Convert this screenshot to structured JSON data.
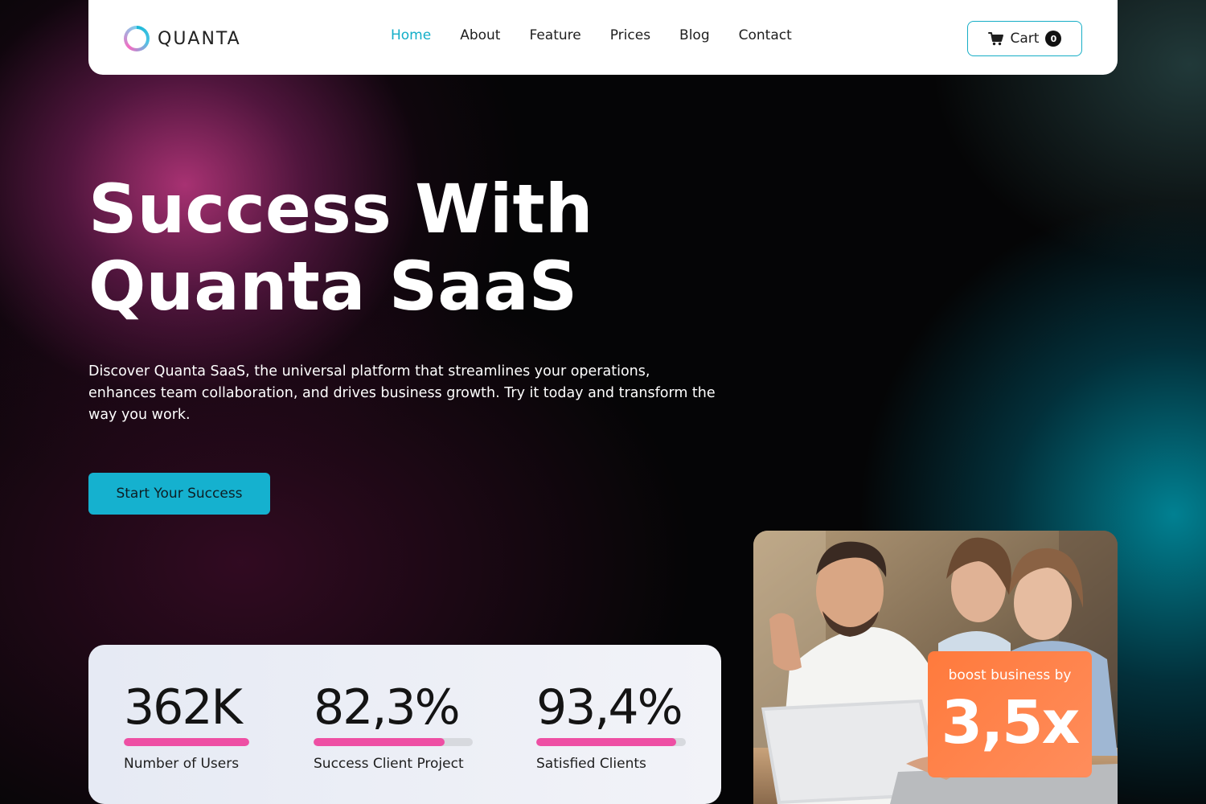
{
  "brand": {
    "name": "QUANTA",
    "icon": "ring-logo-icon"
  },
  "nav": {
    "items": [
      {
        "label": "Home",
        "active": true
      },
      {
        "label": "About",
        "active": false
      },
      {
        "label": "Feature",
        "active": false
      },
      {
        "label": "Prices",
        "active": false
      },
      {
        "label": "Blog",
        "active": false
      },
      {
        "label": "Contact",
        "active": false
      }
    ],
    "cart": {
      "label": "Cart",
      "count": "0",
      "icon": "cart-icon"
    }
  },
  "hero": {
    "title_line1": "Success With",
    "title_line2": "Quanta SaaS",
    "description": "Discover Quanta SaaS, the universal platform that streamlines your operations, enhances team collaboration, and drives business growth. Try it today and transform the way you work.",
    "cta_label": "Start Your Success"
  },
  "stats": [
    {
      "value": "362K",
      "label": "Number of Users",
      "progress": 1.0
    },
    {
      "value": "82,3%",
      "label": "Success Client Project",
      "progress": 0.823
    },
    {
      "value": "93,4%",
      "label": "Satisfied Clients",
      "progress": 0.934
    }
  ],
  "boost": {
    "label": "boost business by",
    "value": "3,5x"
  },
  "colors": {
    "accent": "#15b1cf",
    "progress": "#ee4fa4",
    "boost": "#ff7a3c",
    "nav_active": "#13aec8"
  }
}
